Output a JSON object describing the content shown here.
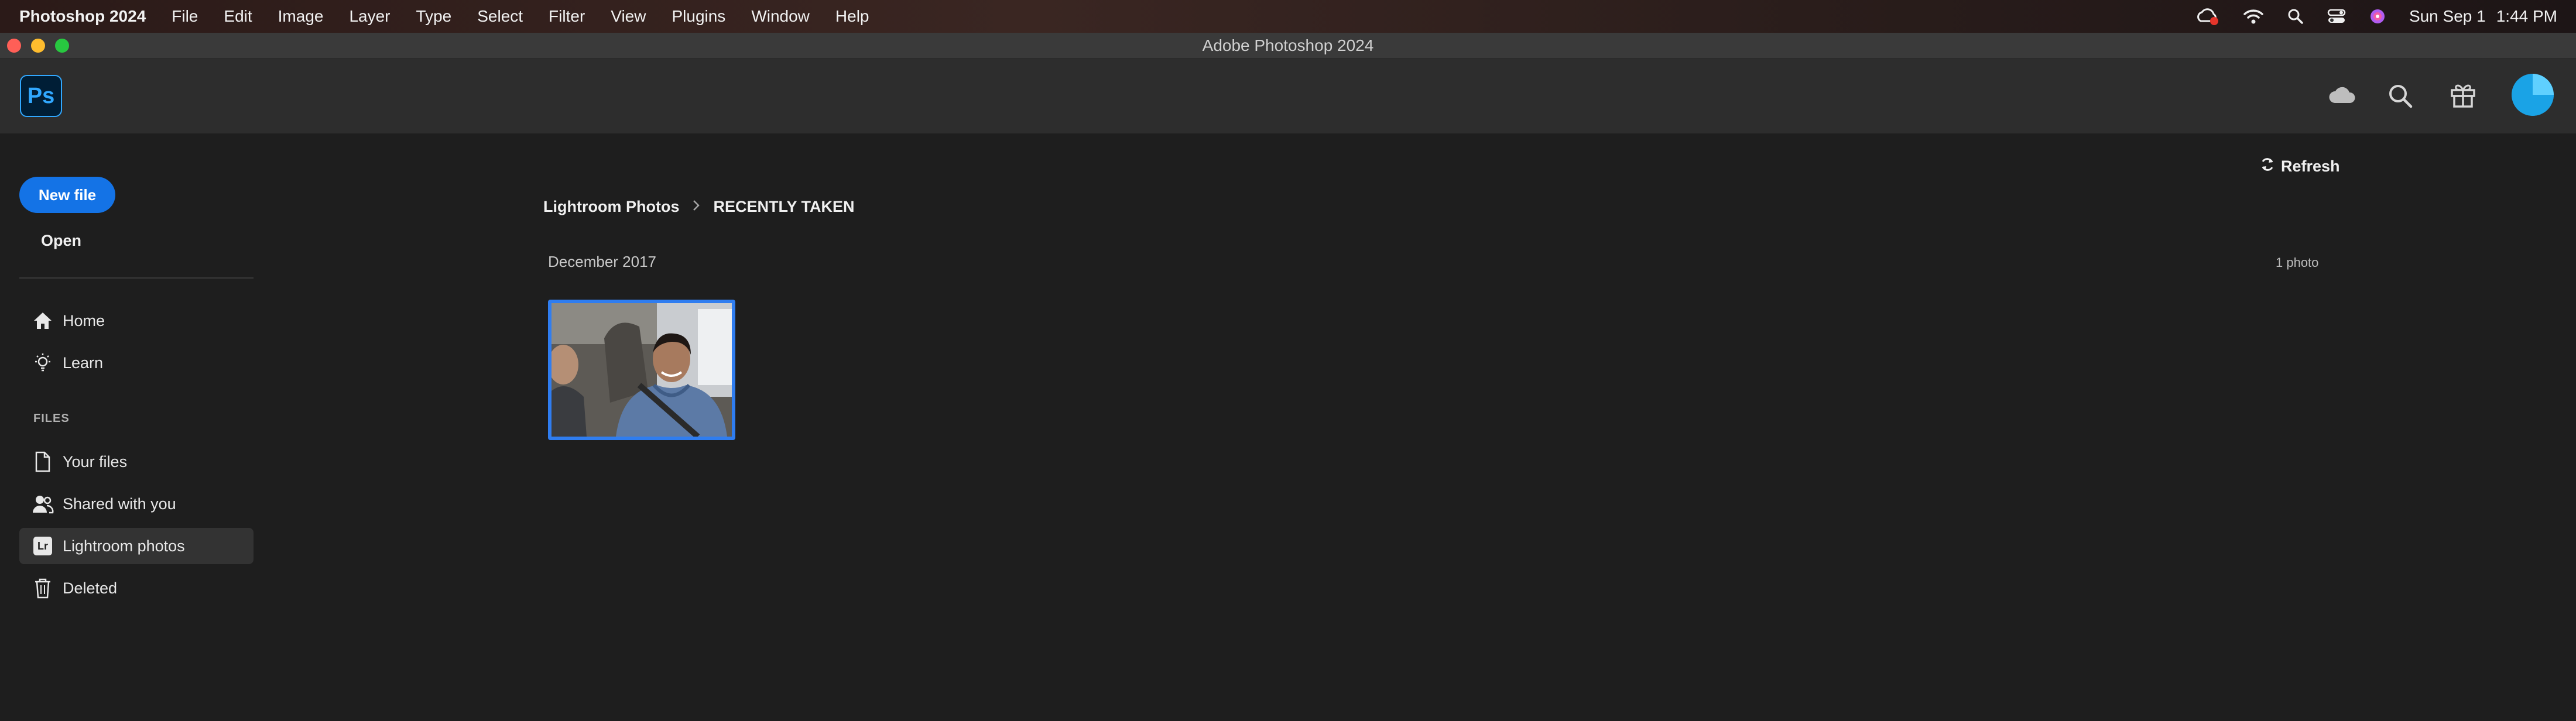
{
  "menubar": {
    "app_name": "Photoshop 2024",
    "items": [
      "File",
      "Edit",
      "Image",
      "Layer",
      "Type",
      "Select",
      "Filter",
      "View",
      "Plugins",
      "Window",
      "Help"
    ],
    "date": "Sun Sep 1",
    "time": "1:44 PM"
  },
  "window": {
    "title": "Adobe Photoshop 2024"
  },
  "header": {
    "logo": "Ps",
    "icons": [
      "cloud-icon",
      "search-icon",
      "gift-icon",
      "avatar"
    ]
  },
  "sidebar": {
    "new_file": "New file",
    "open": "Open",
    "nav": [
      {
        "label": "Home",
        "icon": "home-icon"
      },
      {
        "label": "Learn",
        "icon": "lightbulb-icon"
      }
    ],
    "files_section": "FILES",
    "files": [
      {
        "label": "Your files",
        "icon": "document-icon"
      },
      {
        "label": "Shared with you",
        "icon": "people-icon"
      },
      {
        "label": "Lightroom photos",
        "icon": "lightroom-icon",
        "badge": "Lr",
        "active": true
      },
      {
        "label": "Deleted",
        "icon": "trash-icon"
      }
    ]
  },
  "main": {
    "refresh": "Refresh",
    "breadcrumb": [
      "Lightroom Photos",
      "RECENTLY TAKEN"
    ],
    "group": {
      "date": "December 2017",
      "count": "1 photo"
    }
  },
  "colors": {
    "accent": "#1473e6",
    "selection": "#2f7df0",
    "background": "#1e1e1e",
    "header": "#2d2d2d"
  }
}
